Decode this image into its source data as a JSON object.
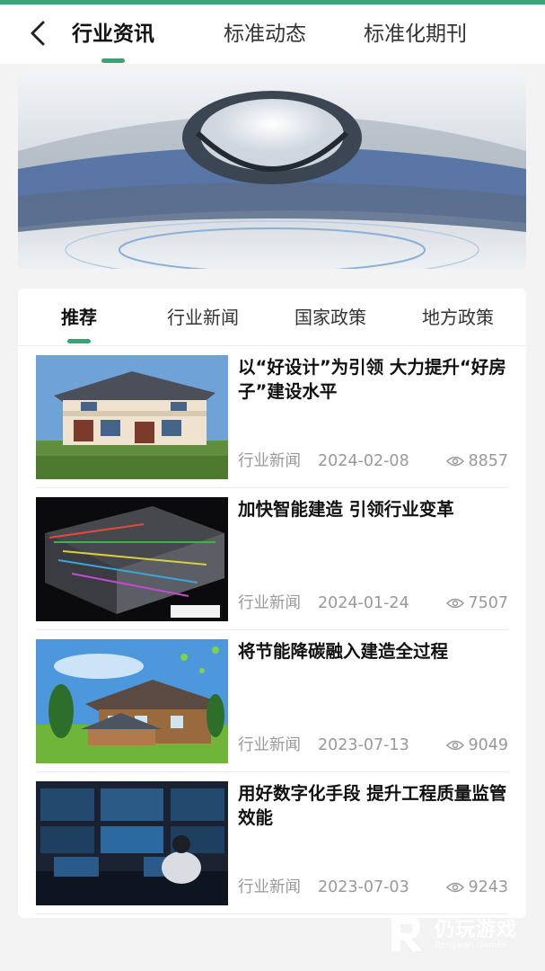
{
  "header": {
    "tabs": [
      {
        "label": "行业资讯",
        "active": true
      },
      {
        "label": "标准动态",
        "active": false
      },
      {
        "label": "标准化期刊",
        "active": false
      }
    ]
  },
  "colors": {
    "accent": "#2fa777",
    "title": "#111111",
    "meta": "#999999"
  },
  "sub_tabs": [
    {
      "label": "推荐",
      "active": true
    },
    {
      "label": "行业新闻",
      "active": false
    },
    {
      "label": "国家政策",
      "active": false
    },
    {
      "label": "地方政策",
      "active": false
    }
  ],
  "news": [
    {
      "title": "以“好设计”为引领 大力提升“好房子”建设水平",
      "category": "行业新闻",
      "date": "2024-02-08",
      "views": "8857"
    },
    {
      "title": "加快智能建造 引领行业变革",
      "category": "行业新闻",
      "date": "2024-01-24",
      "views": "7507"
    },
    {
      "title": "将节能降碳融入建造全过程",
      "category": "行业新闻",
      "date": "2023-07-13",
      "views": "9049"
    },
    {
      "title": "用好数字化手段 提升工程质量监管效能",
      "category": "行业新闻",
      "date": "2023-07-03",
      "views": "9243"
    }
  ],
  "watermark": {
    "text": "仍玩游戏",
    "sub": "Rengwan Games"
  }
}
